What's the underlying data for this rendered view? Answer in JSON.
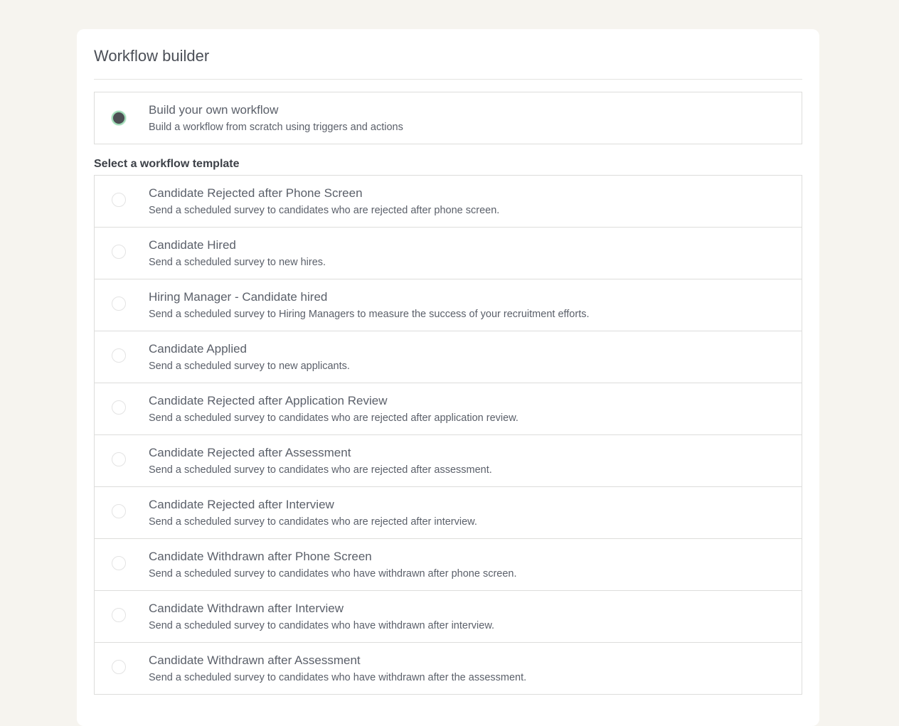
{
  "page": {
    "title": "Workflow builder"
  },
  "own_workflow": {
    "title": "Build your own workflow",
    "description": "Build a workflow from scratch using triggers and actions",
    "selected": true
  },
  "templates": {
    "section_label": "Select a workflow template",
    "items": [
      {
        "title": "Candidate Rejected after Phone Screen",
        "description": "Send a scheduled survey to candidates who are rejected after phone screen."
      },
      {
        "title": "Candidate Hired",
        "description": "Send a scheduled survey to new hires."
      },
      {
        "title": "Hiring Manager - Candidate hired",
        "description": "Send a scheduled survey to Hiring Managers to measure the success of your recruitment efforts."
      },
      {
        "title": "Candidate Applied",
        "description": "Send a scheduled survey to new applicants."
      },
      {
        "title": "Candidate Rejected after Application Review",
        "description": "Send a scheduled survey to candidates who are rejected after application review."
      },
      {
        "title": "Candidate Rejected after Assessment",
        "description": "Send a scheduled survey to candidates who are rejected after assessment."
      },
      {
        "title": "Candidate Rejected after Interview",
        "description": "Send a scheduled survey to candidates who are rejected after interview."
      },
      {
        "title": "Candidate Withdrawn after Phone Screen",
        "description": "Send a scheduled survey to candidates who have withdrawn after phone screen."
      },
      {
        "title": "Candidate Withdrawn after Interview",
        "description": "Send a scheduled survey to candidates who have withdrawn after interview."
      },
      {
        "title": "Candidate Withdrawn after Assessment",
        "description": "Send a scheduled survey to candidates who have withdrawn after the assessment."
      }
    ]
  },
  "colors": {
    "page_background": "#f6f4ef",
    "card_background": "#ffffff",
    "radio_selected_fill": "#4d4f54",
    "radio_selected_ring": "#9cd9b4",
    "border": "#dddddb"
  }
}
